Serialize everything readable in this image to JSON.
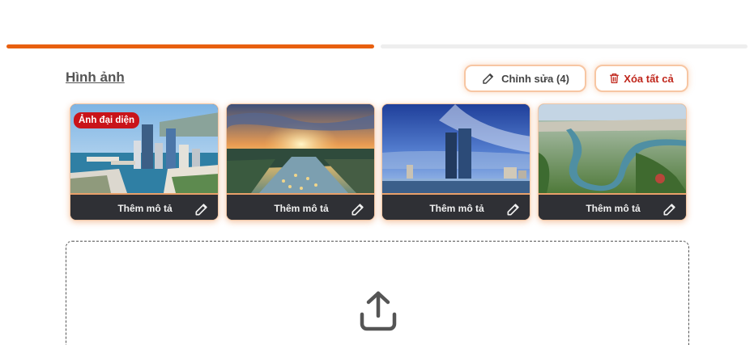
{
  "progress": {
    "steps": 2,
    "active_step": 1,
    "colors": {
      "active": "#e8600f",
      "inactive": "#eeeeee"
    }
  },
  "images_section": {
    "title": "Hình ảnh",
    "edit_button": {
      "label": "Chỉnh sửa (4)",
      "icon": "pencil-icon"
    },
    "delete_all_button": {
      "label": "Xóa tất cả",
      "icon": "trash-icon",
      "color": "#c0261b"
    },
    "items": [
      {
        "badge": "Ảnh đại diện",
        "caption": "Thêm mô tả",
        "edit_icon": "pencil-icon"
      },
      {
        "badge": "",
        "caption": "Thêm mô tả",
        "edit_icon": "pencil-icon"
      },
      {
        "badge": "",
        "caption": "Thêm mô tả",
        "edit_icon": "pencil-icon"
      },
      {
        "badge": "",
        "caption": "Thêm mô tả",
        "edit_icon": "pencil-icon"
      }
    ]
  },
  "upload": {
    "icon": "upload-icon"
  },
  "colors": {
    "accent": "#e8600f",
    "danger": "#c9141a",
    "caption_bar": "#2f3035"
  }
}
